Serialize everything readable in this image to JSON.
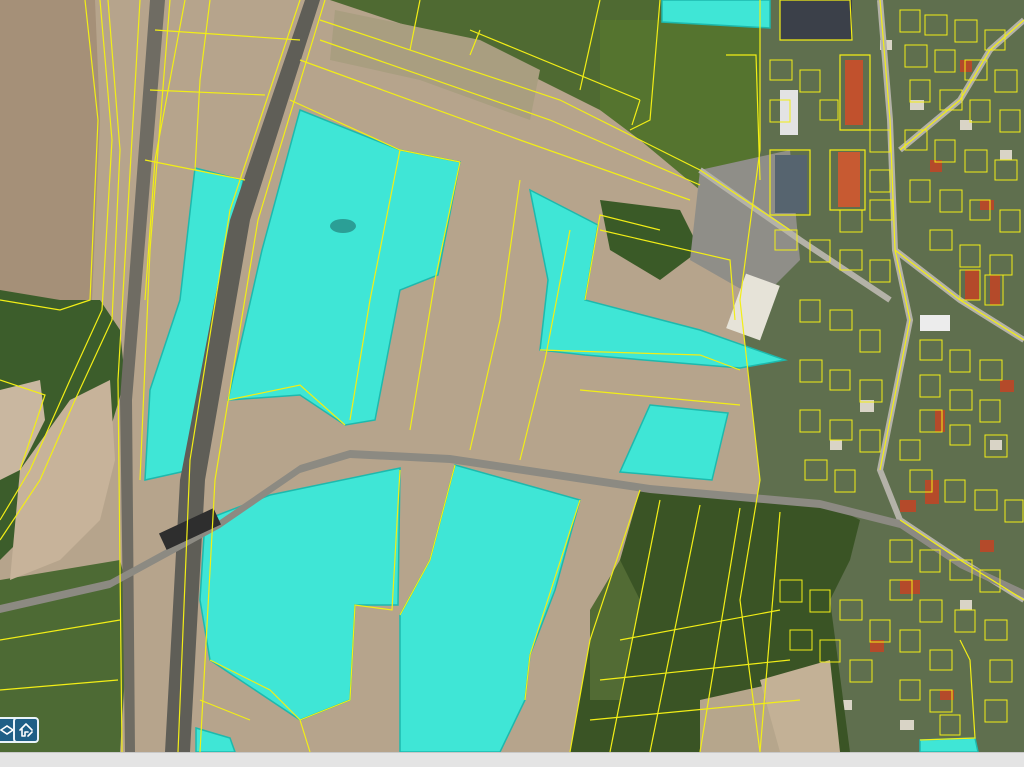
{
  "map": {
    "view": "aerial-orthophoto",
    "layers": [
      "cadastral-parcels",
      "highlighted-parcels"
    ],
    "colors": {
      "parcel_boundary": "#f2ee16",
      "highlight_fill": "#3fe6d6",
      "highlight_stroke": "#1db9ad",
      "field_bare": "#b8a58c",
      "field_green": "#3f5a24",
      "highway": "#6c6a62",
      "toolbar": "#1f5f86"
    }
  },
  "toolbar": {
    "buttons": [
      {
        "icon": "layer-toggle-icon"
      },
      {
        "icon": "home-extent-icon"
      }
    ]
  }
}
